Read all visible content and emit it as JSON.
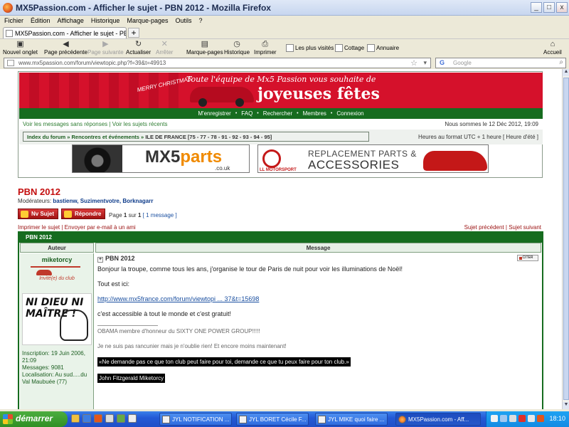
{
  "browser": {
    "window_title": "MX5Passion.com - Afficher le sujet - PBN 2012 - Mozilla Firefox",
    "window_buttons": [
      "_",
      "□",
      "x"
    ],
    "menu": [
      "Fichier",
      "Édition",
      "Affichage",
      "Historique",
      "Marque-pages",
      "Outils",
      "?"
    ],
    "tab_title": "MX5Passion.com - Afficher le sujet - PBN 2012",
    "new_tab": "+",
    "toolbar": {
      "new_tab": "Nouvel onglet",
      "back": "Page précédente",
      "forward": "Page suivante",
      "reload": "Actualiser",
      "stop": "Arrêter",
      "bookmarks": "Marque-pages",
      "history": "Historique",
      "print": "Imprimer",
      "home": "Accueil"
    },
    "bookmarks_bar": [
      "Les plus visités",
      "Cottage",
      "Annuaire"
    ],
    "url": "www.mx5passion.com/forum/viewtopic.php?f=39&t=49913",
    "search_placeholder": "Google",
    "search_engine_icon": "G"
  },
  "forum": {
    "banner": {
      "greeting": "Toute l'équipe de Mx5 Passion vous souhaite de",
      "headline": "joyeuses fêtes",
      "xmas": "MERRY CHRISTMAS"
    },
    "nav": [
      "M'enregistrer",
      "FAQ",
      "Rechercher",
      "Membres",
      "Connexion"
    ],
    "nav_sep": "•",
    "subnav_left_1": "Voir les messages sans réponses",
    "subnav_sep": " | ",
    "subnav_left_2": "Voir les sujets récents",
    "date_text": "Nous sommes le 12 Déc 2012, 19:09",
    "breadcrumb": {
      "index": "Index du forum",
      "sep": " » ",
      "section": "Rencontres et événements",
      "current": "ILE DE FRANCE [75 - 77 - 78 - 91 - 92 - 93 - 94 - 95]"
    },
    "timezone": "Heures au format UTC + 1 heure [ Heure d'été ]",
    "ad1": {
      "logo_a": "MX5",
      "logo_b": "parts",
      "domain": ".co.uk"
    },
    "ad2": {
      "line1": "REPLACEMENT PARTS &",
      "line2": "ACCESSORIES",
      "brand": "LL MOTORSPORT"
    },
    "topic_title": "PBN 2012",
    "moderators_label": "Modérateurs:",
    "moderators": "bastienw, Suzimentvotre, Borknagarr",
    "btn_new_topic": "Nv Sujet",
    "btn_reply": "Répondre",
    "page_info_prefix": "Page",
    "page_current": "1",
    "page_sep": "sur",
    "page_total": "1",
    "message_count": "[ 1 message ]",
    "util_print": "Imprimer le sujet",
    "util_sep": " | ",
    "util_email": "Envoyer par e-mail à un ami",
    "util_prev": "Sujet précédent",
    "util_next": "Sujet suivant",
    "table_title": "PBN 2012",
    "col_author": "Auteur",
    "col_message": "Message"
  },
  "post": {
    "author": "miketorcy",
    "rank": "Invité(e) du club",
    "avatar_text": "NI DIEU NI MAÎTRE !",
    "stats": [
      "Inscription: 19 Juin 2006, 21:09",
      "Messages: 9081",
      "Localisation: Au sud.....du Val Maubuée (77)"
    ],
    "subject": "PBN 2012",
    "quote_btn": "CITER",
    "paragraphs": [
      "Bonjour la troupe, comme tous les ans, j'organise le tour de Paris de nuit pour voir les illuminations de Noël!",
      "Tout est ici:"
    ],
    "link": "http://www.mx5france.com/forum/viewtopi ... 37&t=15698",
    "paragraph_after_link": "c'est accessible à tout le monde et c'est gratuit!",
    "signature": [
      "OBAMA membre d'honneur du SIXTY ONE POWER GROUP!!!!!",
      "Je ne suis pas rancunier mais je n'oublie rien! Et encore moins maintenant!"
    ],
    "quote_line": "«Ne demande pas ce que ton club peut faire pour toi, demande ce que tu peux faire pour ton club.»",
    "quote_author": "John Fitzgerald Miketorcy"
  },
  "taskbar": {
    "start": "démarrer",
    "tasks": [
      "JYL  NOTIFICATION ...",
      "JYL  BORET Cécile  F...",
      "JYL  MIKE quoi faire ...",
      "MX5Passion.com - Aff..."
    ],
    "clock": "18:10"
  }
}
